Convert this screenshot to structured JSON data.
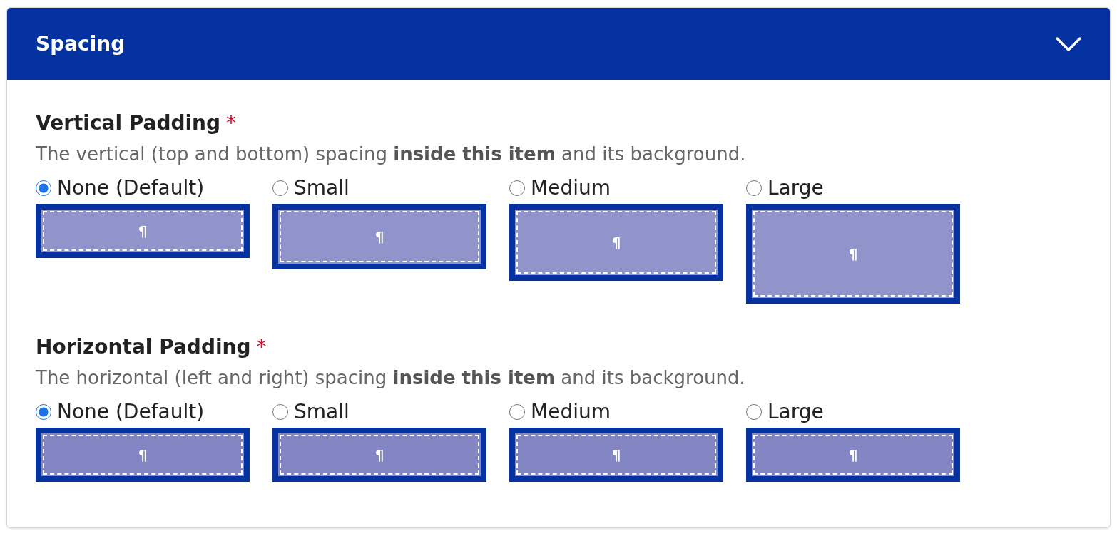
{
  "panel": {
    "title": "Spacing",
    "expanded": true
  },
  "sections": [
    {
      "kind": "vertical",
      "label": "Vertical Padding",
      "required_mark": "*",
      "description": "The vertical (top and bottom) spacing **inside this item** and its background.",
      "options": [
        {
          "label": "None (Default)",
          "selected": true,
          "preview": "¶"
        },
        {
          "label": "Small",
          "selected": false,
          "preview": "¶"
        },
        {
          "label": "Medium",
          "selected": false,
          "preview": "¶"
        },
        {
          "label": "Large",
          "selected": false,
          "preview": "¶"
        }
      ]
    },
    {
      "kind": "horizontal",
      "label": "Horizontal Padding",
      "required_mark": "*",
      "description": "The horizontal (left and right) spacing **inside this item** and its background.",
      "options": [
        {
          "label": "None (Default)",
          "selected": true,
          "preview": "¶"
        },
        {
          "label": "Small",
          "selected": false,
          "preview": "¶"
        },
        {
          "label": "Medium",
          "selected": false,
          "preview": "¶"
        },
        {
          "label": "Large",
          "selected": false,
          "preview": "¶"
        }
      ]
    }
  ]
}
